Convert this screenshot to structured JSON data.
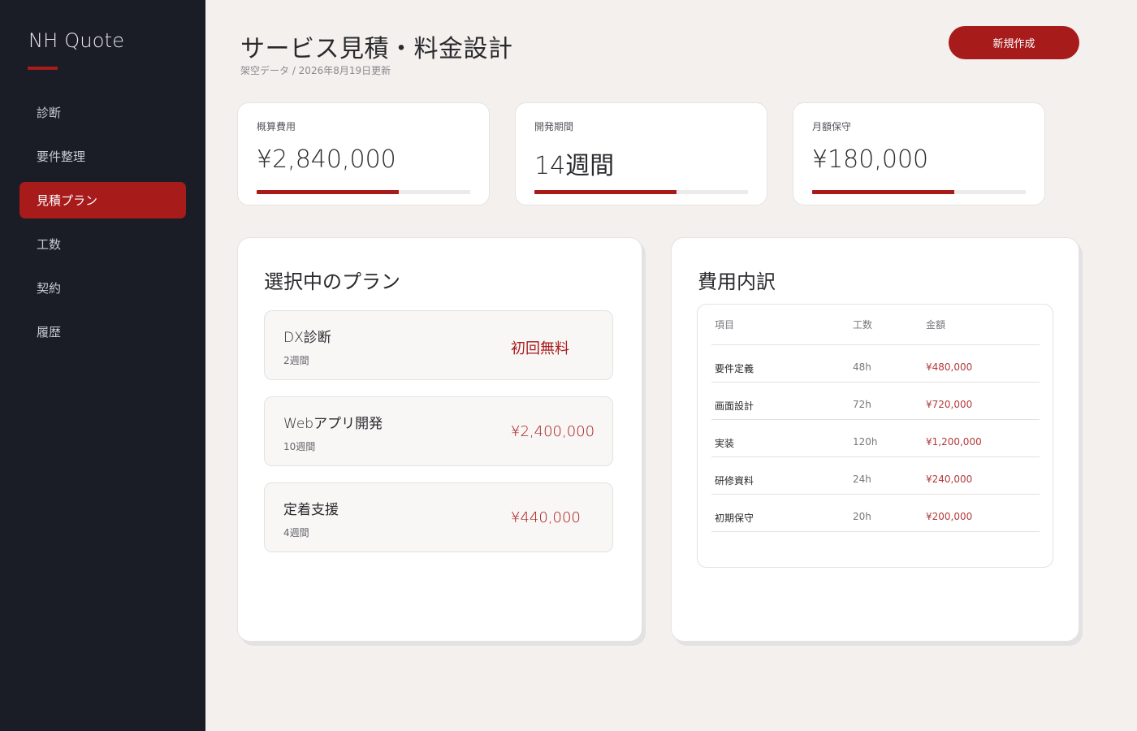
{
  "brand": "NH Quote",
  "nav": [
    {
      "label": "診断",
      "active": false
    },
    {
      "label": "要件整理",
      "active": false
    },
    {
      "label": "見積プラン",
      "active": true
    },
    {
      "label": "工数",
      "active": false
    },
    {
      "label": "契約",
      "active": false
    },
    {
      "label": "履歴",
      "active": false
    }
  ],
  "header": {
    "title": "サービス見積・料金設計",
    "subtitle": "架空データ / 2026年8月19日更新",
    "new_button": "新規作成"
  },
  "kpis": [
    {
      "label": "概算費用",
      "value": "¥2,840,000",
      "progress": 0.665
    },
    {
      "label": "開発期間",
      "value": "14週間",
      "progress": 0.665
    },
    {
      "label": "月額保守",
      "value": "¥180,000",
      "progress": 0.665
    }
  ],
  "plans_panel": {
    "title": "選択中のプラン",
    "plans": [
      {
        "name": "DX診断",
        "duration": "2週間",
        "price": "初回無料"
      },
      {
        "name": "Webアプリ開発",
        "duration": "10週間",
        "price": "¥2,400,000"
      },
      {
        "name": "定着支援",
        "duration": "4週間",
        "price": "¥440,000"
      }
    ]
  },
  "cost_panel": {
    "title": "費用内訳",
    "columns": [
      "項目",
      "工数",
      "金額"
    ],
    "rows": [
      {
        "item": "要件定義",
        "hours": "48h",
        "amount": "¥480,000"
      },
      {
        "item": "画面設計",
        "hours": "72h",
        "amount": "¥720,000"
      },
      {
        "item": "実装",
        "hours": "120h",
        "amount": "¥1,200,000"
      },
      {
        "item": "研修資料",
        "hours": "24h",
        "amount": "¥240,000"
      },
      {
        "item": "初期保守",
        "hours": "20h",
        "amount": "¥200,000"
      }
    ]
  },
  "colors": {
    "accent": "#a81b1b",
    "sidebar": "#1a1d26",
    "background": "#f3f0ed"
  }
}
